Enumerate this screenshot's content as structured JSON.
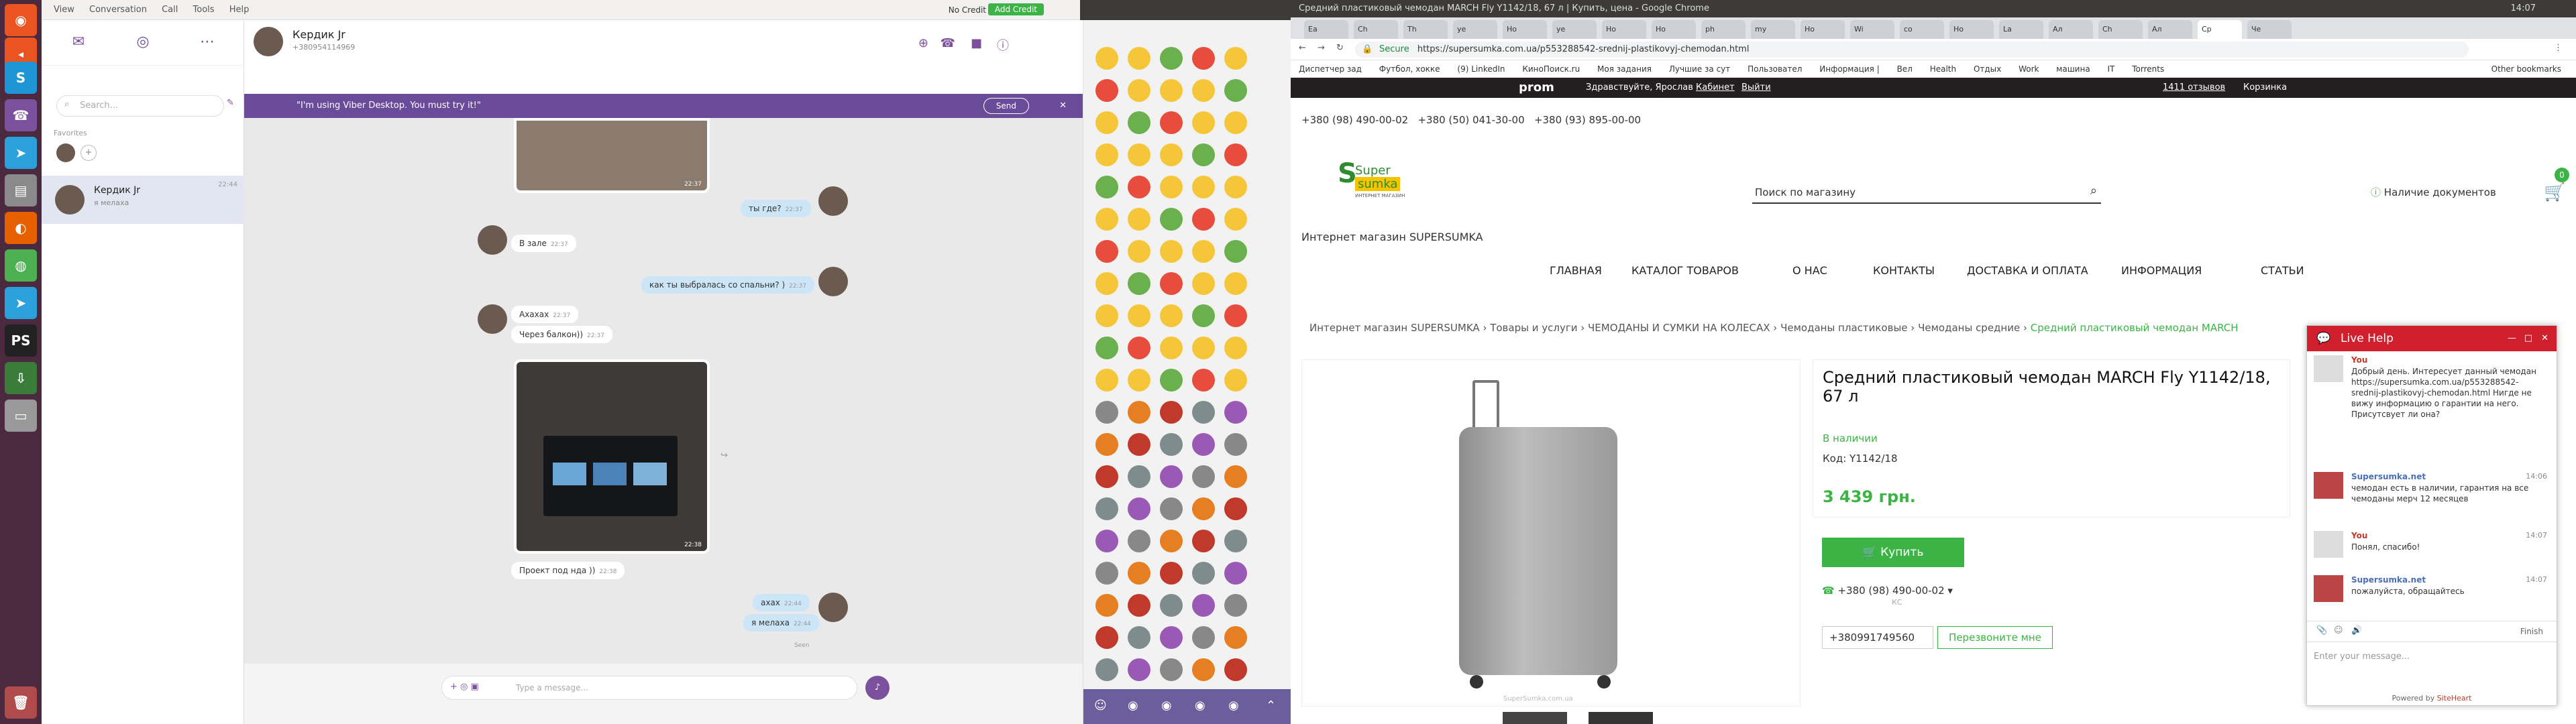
{
  "viber": {
    "menu": [
      "View",
      "Conversation",
      "Call",
      "Tools",
      "Help"
    ],
    "credit": "No Credit",
    "add_credit": "Add Credit",
    "search_placeholder": "Search...",
    "favorites_label": "Favorites",
    "contact": {
      "name": "Кердик Jr",
      "status": "я мелаха",
      "time": "22:44"
    },
    "header": {
      "name": "Кердик Jr",
      "phone": "+380954114969"
    },
    "banner": "\"I'm using Viber Desktop. You must try it!\"",
    "banner_send": "Send",
    "messages": [
      {
        "dir": "out",
        "text": "ты где?",
        "time": "22:37"
      },
      {
        "dir": "in",
        "text": "В зале",
        "time": "22:37"
      },
      {
        "dir": "out",
        "text": "как ты выбралась со спальни? )",
        "time": "22:37"
      },
      {
        "dir": "in",
        "text": "Ахахах",
        "time": "22:37"
      },
      {
        "dir": "in",
        "text": "Через балкон))",
        "time": "22:37"
      },
      {
        "dir": "in",
        "text": "Проект под нда ))",
        "time": "22:38"
      },
      {
        "dir": "out",
        "text": "ахах",
        "time": "22:44"
      },
      {
        "dir": "out",
        "text": "я мелаха",
        "time": "22:44"
      }
    ],
    "photo_times": [
      "22:37",
      "22:38"
    ],
    "seen": "Seen",
    "input_placeholder": "Type a message..."
  },
  "chrome": {
    "os_title": "Средний пластиковый чемодан MARCH Fly Y1142/18, 67 л | Купить, цена - Google Chrome",
    "os_time": "14:07",
    "tabs": [
      "Ea",
      "Ch",
      "Th",
      "ye",
      "Но",
      "ye",
      "Но",
      "Но",
      "ph",
      "my",
      "Но",
      "Wi",
      "со",
      "Но",
      "La",
      "Ал",
      "Ch",
      "Ал",
      "Ср",
      "Че"
    ],
    "secure": "Secure",
    "url": "https://supersumka.com.ua/p553288542-srednij-plastikovyj-chemodan.html",
    "bookmarks": [
      "Диспетчер зад",
      "Футбол, хокке",
      "(9) LinkedIn",
      "КиноПоиск.ru",
      "Моя задания",
      "Лучшие за сут",
      "Пользовател",
      "Информация |",
      "Вел",
      "Health",
      "Отдых",
      "Work",
      "машина",
      "IT",
      "Torrents",
      "Other bookmarks"
    ],
    "prom": {
      "logo": "prom",
      "greeting": "Здравствуйте, Ярослав",
      "cabinet": "Кабинет",
      "logout": "Выйти",
      "reviews": "1411 отзывов",
      "cart": "Корзинка"
    }
  },
  "site": {
    "phones": [
      "+380 (98) 490-00-02",
      "+380 (50) 041-30-00",
      "+380 (93) 895-00-00"
    ],
    "logo_super": "Super",
    "logo_sumka": "sumka",
    "logo_sub": "ИНТЕРНЕТ МАГАЗИН",
    "search_placeholder": "Поиск по магазину",
    "docs": "Наличие документов",
    "cart_count": "0",
    "store_name": "Интернет магазин SUPERSUMKA",
    "nav": [
      "ГЛАВНАЯ",
      "КАТАЛОГ ТОВАРОВ",
      "О НАС",
      "КОНТАКТЫ",
      "ДОСТАВКА И ОПЛАТА",
      "ИНФОРМАЦИЯ",
      "СТАТЬИ"
    ],
    "breadcrumb": [
      "Интернет магазин SUPERSUMKA",
      "Товары и услуги",
      "ЧЕМОДАНЫ И СУМКИ НА КОЛЕСАХ",
      "Чемоданы пластиковые",
      "Чемоданы средние",
      "Средний пластиковый чемодан MARCH"
    ],
    "product": {
      "title": "Средний пластиковый чемодан MARCH Fly Y1142/18, 67 л",
      "stock": "В наличии",
      "code": "Код: Y1142/18",
      "price": "3 439 грн.",
      "buy": "Купить",
      "phone": "+380 (98) 490-00-02",
      "phone_sub": "КС",
      "callback_phone": "+380991749560",
      "callback_btn": "Перезвоните мне",
      "watermark": "SuperSumka.com.ua"
    },
    "live": {
      "title": "Live Help",
      "messages": [
        {
          "name": "You",
          "time": "",
          "text": "Добрый день. Интересует данный чемодан https://supersumka.com.ua/p553288542-srednij-plastikovyj-chemodan.html Нигде не вижу информацию о гарантии на него. Присутсвует ли она?"
        },
        {
          "name": "Supersumka.net",
          "time": "14:06",
          "text": "чемодан есть в наличии, гарантия на все чемоданы мерч 12 месяцев"
        },
        {
          "name": "You",
          "time": "14:07",
          "text": "Понял, спасибо!"
        },
        {
          "name": "Supersumka.net",
          "time": "14:07",
          "text": "пожалуйста, обращайтесь"
        }
      ],
      "finish": "Finish",
      "input_placeholder": "Enter your message...",
      "powered": "Powered by",
      "powered_brand": "SiteHeart"
    }
  }
}
